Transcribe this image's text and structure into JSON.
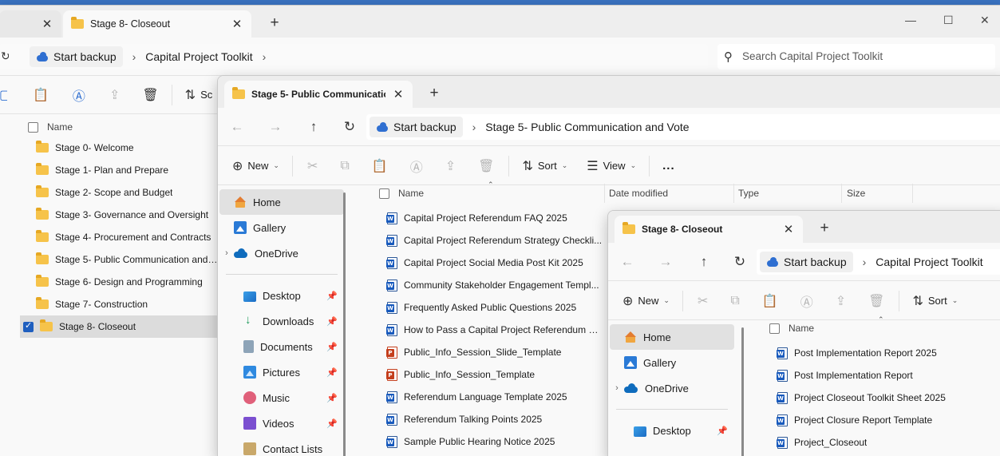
{
  "back": {
    "tabs": [
      {
        "label": ""
      },
      {
        "label": "Stage 8- Closeout"
      }
    ],
    "address": {
      "backup": "Start backup",
      "crumb": "Capital Project Toolkit"
    },
    "search_placeholder": "Search Capital Project Toolkit",
    "toolbar": {
      "sort_partial": "Sc"
    },
    "list_header": "Name",
    "folders": [
      "Stage 0- Welcome",
      "Stage 1- Plan and Prepare",
      "Stage 2- Scope and Budget",
      "Stage 3- Governance and Oversight",
      "Stage 4- Procurement and Contracts",
      "Stage 5- Public Communication and Vote",
      "Stage 6- Design and Programming",
      "Stage 7- Construction",
      "Stage 8- Closeout"
    ]
  },
  "mid": {
    "tab": "Stage 5- Public Communicatio",
    "address": {
      "backup": "Start backup",
      "crumb": "Stage 5- Public Communication and Vote"
    },
    "toolbar": {
      "new": "New",
      "sort": "Sort",
      "view": "View",
      "more": "..."
    },
    "nav": {
      "home": "Home",
      "gallery": "Gallery",
      "onedrive": "OneDrive",
      "desktop": "Desktop",
      "downloads": "Downloads",
      "documents": "Documents",
      "pictures": "Pictures",
      "music": "Music",
      "videos": "Videos",
      "contacts": "Contact Lists"
    },
    "columns": {
      "name": "Name",
      "date": "Date modified",
      "type": "Type",
      "size": "Size"
    },
    "files": [
      {
        "name": "Capital Project Referendum FAQ 2025",
        "icon": "word"
      },
      {
        "name": "Capital Project Referendum Strategy Checkli...",
        "icon": "word"
      },
      {
        "name": "Capital Project Social Media Post Kit 2025",
        "icon": "word"
      },
      {
        "name": "Community Stakeholder Engagement Templ...",
        "icon": "word"
      },
      {
        "name": "Frequently Asked Public Questions 2025",
        "icon": "word"
      },
      {
        "name": "How to Pass a Capital Project Referendum S...",
        "icon": "word"
      },
      {
        "name": "Public_Info_Session_Slide_Template",
        "icon": "powerpoint"
      },
      {
        "name": "Public_Info_Session_Template",
        "icon": "powerpoint"
      },
      {
        "name": "Referendum Language Template 2025",
        "icon": "word"
      },
      {
        "name": "Referendum Talking Points 2025",
        "icon": "word"
      },
      {
        "name": "Sample Public Hearing Notice 2025",
        "icon": "word"
      }
    ]
  },
  "front": {
    "tab": "Stage 8- Closeout",
    "address": {
      "backup": "Start backup",
      "crumb": "Capital Project Toolkit"
    },
    "toolbar": {
      "new": "New",
      "sort": "Sort"
    },
    "nav": {
      "home": "Home",
      "gallery": "Gallery",
      "onedrive": "OneDrive",
      "desktop": "Desktop"
    },
    "columns": {
      "name": "Name"
    },
    "files": [
      "Post Implementation Report 2025",
      "Post Implementation Report",
      "Project Closeout Toolkit Sheet 2025",
      "Project Closure Report Template",
      "Project_Closeout"
    ]
  },
  "colors": {
    "accent": "#1f5fbf",
    "folder": "#f6c34a",
    "word": "#185abd",
    "powerpoint": "#c43e1c"
  }
}
